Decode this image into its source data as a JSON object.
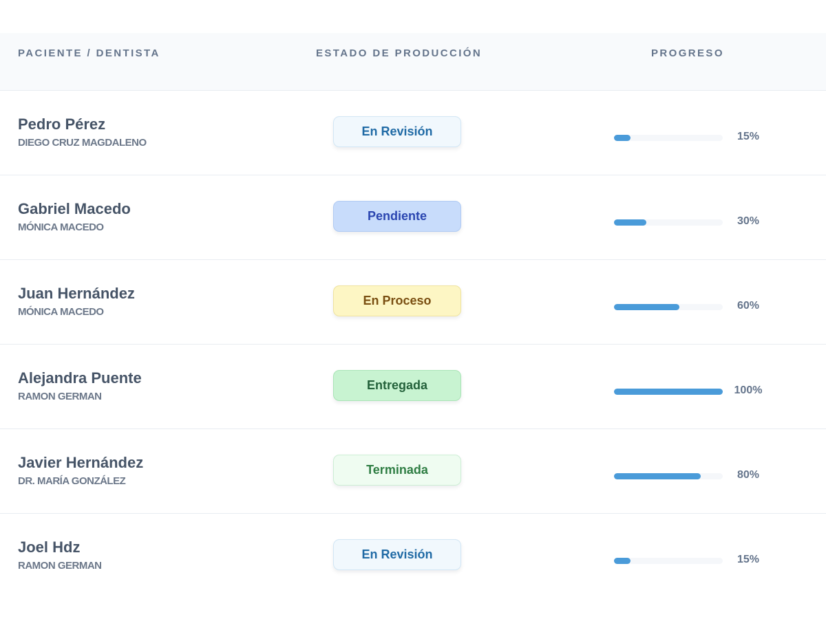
{
  "header": {
    "patient_col": "PACIENTE / DENTISTA",
    "status_col": "ESTADO DE PRODUCCIÓN",
    "progress_col": "PROGRESO"
  },
  "rows": [
    {
      "patient": "Pedro Pérez",
      "dentist": "DIEGO CRUZ MAGDALENO",
      "status": "En Revisión",
      "status_type": "revision",
      "progress": 15,
      "progress_label": "15%"
    },
    {
      "patient": "Gabriel Macedo",
      "dentist": "MÓNICA MACEDO",
      "status": "Pendiente",
      "status_type": "pending",
      "progress": 30,
      "progress_label": "30%"
    },
    {
      "patient": "Juan Hernández",
      "dentist": "MÓNICA MACEDO",
      "status": "En Proceso",
      "status_type": "process",
      "progress": 60,
      "progress_label": "60%"
    },
    {
      "patient": "Alejandra Puente",
      "dentist": "RAMON GERMAN",
      "status": "Entregada",
      "status_type": "delivered",
      "progress": 100,
      "progress_label": "100%"
    },
    {
      "patient": "Javier Hernández",
      "dentist": "DR. MARÍA GONZÁLEZ",
      "status": "Terminada",
      "status_type": "finished",
      "progress": 80,
      "progress_label": "80%"
    },
    {
      "patient": "Joel Hdz",
      "dentist": "RAMON GERMAN",
      "status": "En Revisión",
      "status_type": "revision",
      "progress": 15,
      "progress_label": "15%"
    }
  ],
  "colors": {
    "progress_fill": "#4a9bd9",
    "progress_track": "#f5f7fa"
  }
}
